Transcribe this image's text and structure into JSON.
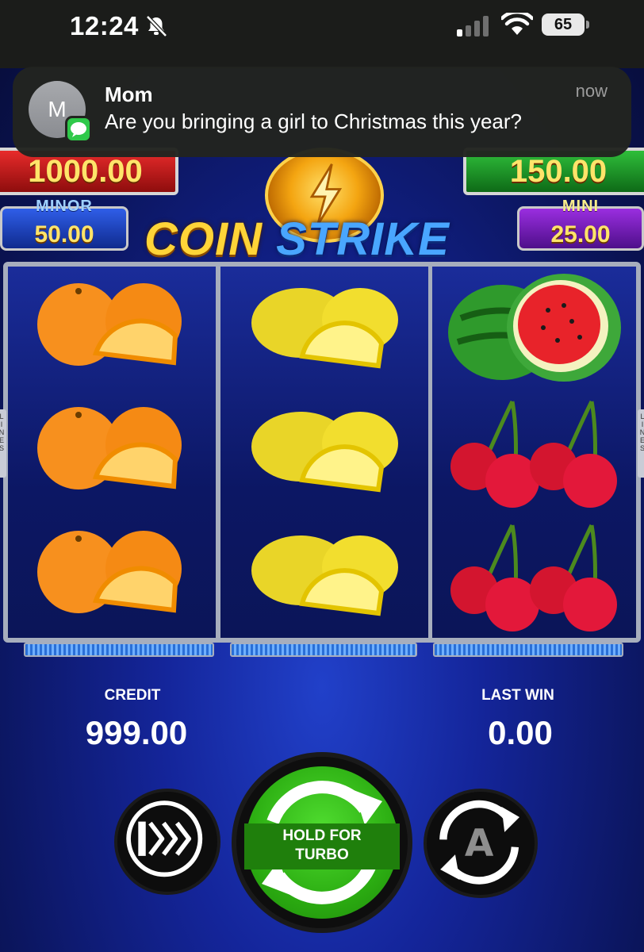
{
  "status_bar": {
    "time": "12:24",
    "battery": "65",
    "icons": [
      "bell-muted-icon",
      "cellular-signal-icon",
      "wifi-icon",
      "battery-icon"
    ]
  },
  "notification": {
    "avatar_initial": "M",
    "sender": "Mom",
    "time": "now",
    "message": "Are you bringing a girl to Christmas this year?",
    "app_icon": "messages-icon"
  },
  "game": {
    "title_part1": "COIN",
    "title_part2": "STRIKE",
    "jackpots": {
      "major_value": "1000.00",
      "grand_value": "150.00",
      "minor_label": "MINOR",
      "minor_value": "50.00",
      "mini_label": "MINI",
      "mini_value": "25.00"
    },
    "side_tab_text": "LINES",
    "reels": [
      [
        "orange",
        "orange",
        "orange"
      ],
      [
        "lemon",
        "lemon",
        "lemon"
      ],
      [
        "watermelon",
        "cherry",
        "cherry"
      ]
    ],
    "credit_label": "CREDIT",
    "credit_value": "999.00",
    "last_win_label": "LAST WIN",
    "last_win_value": "0.00",
    "spin_button_text": "HOLD FOR TURBO",
    "colors": {
      "spin_green": "#2cae12",
      "background_blue": "#14259a",
      "jackpot_gold": "#ffe46a"
    }
  }
}
